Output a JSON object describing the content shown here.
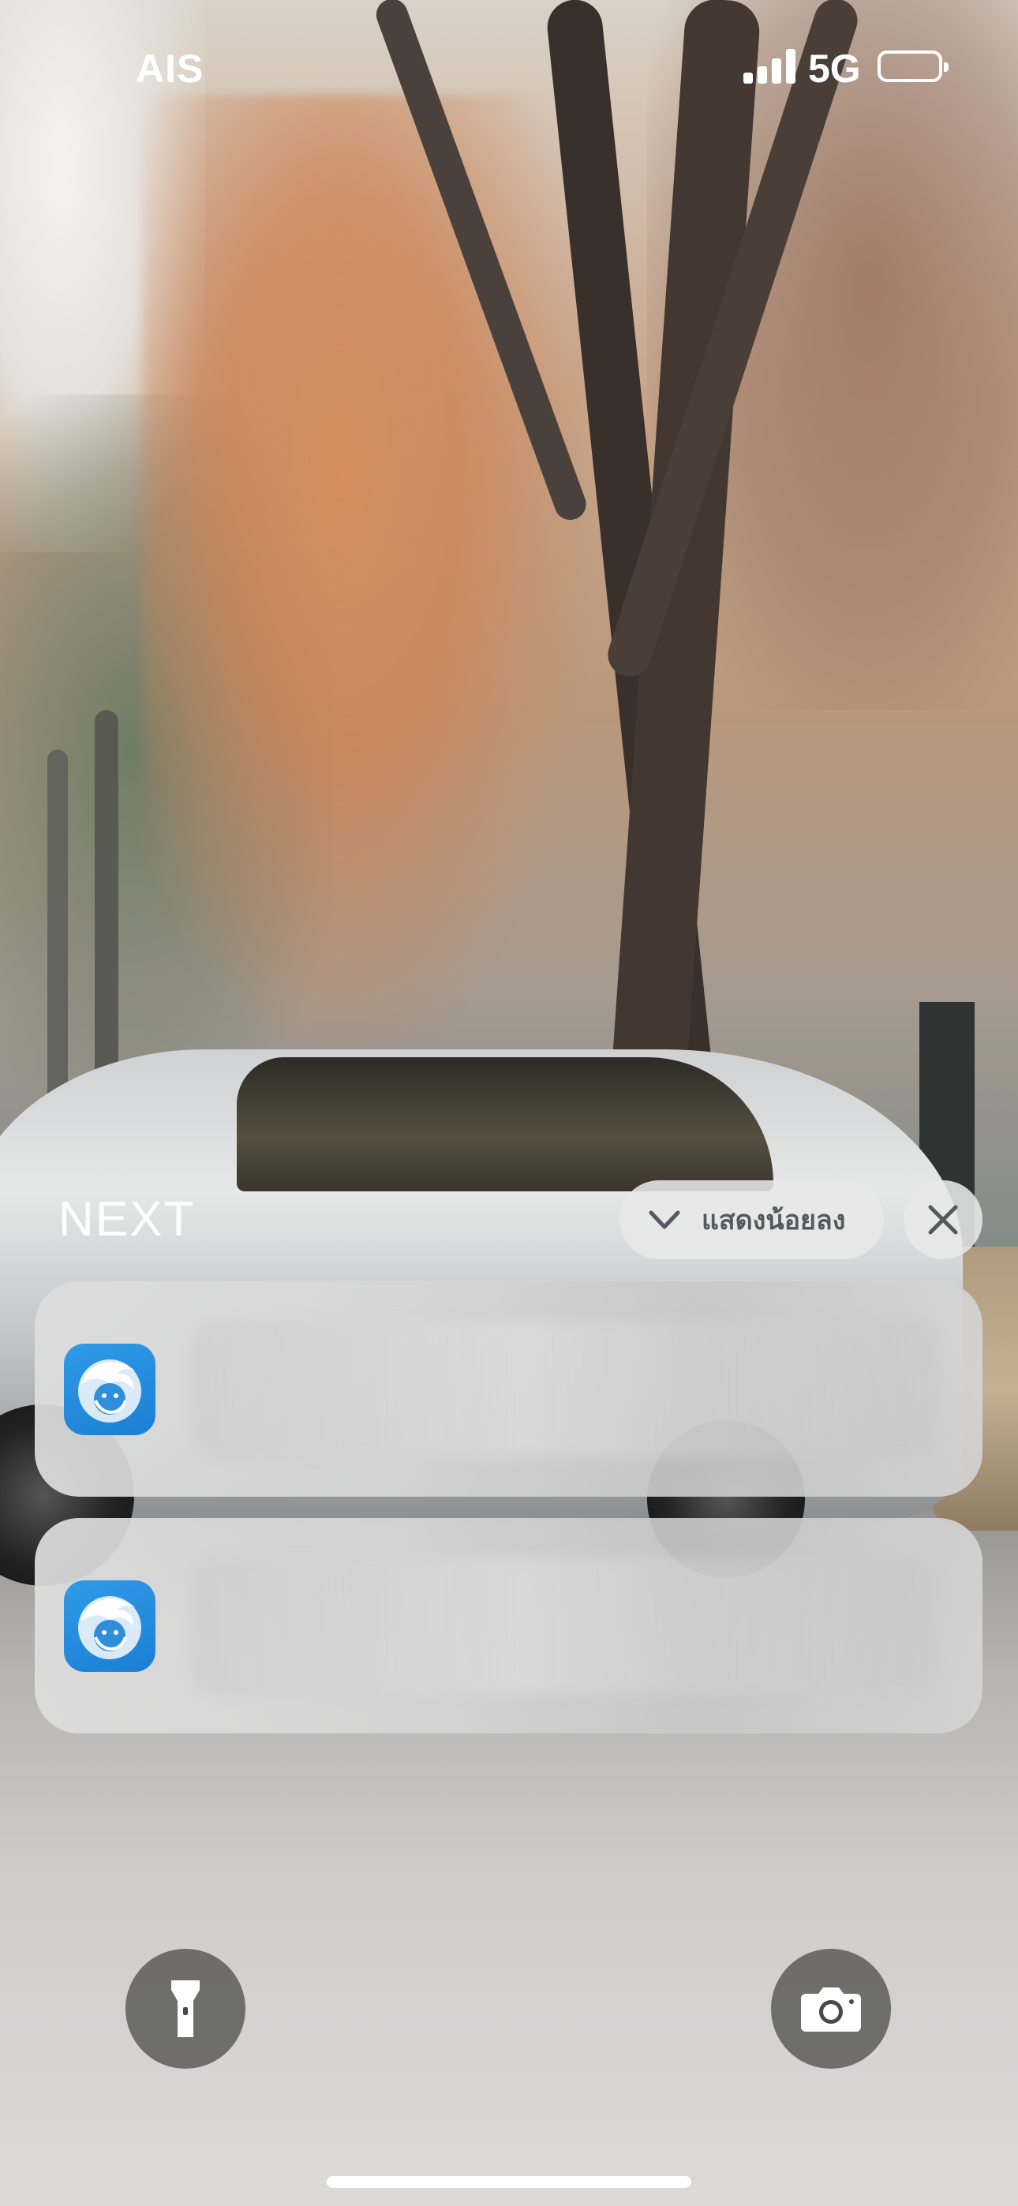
{
  "status_bar": {
    "carrier": "AIS",
    "network_type": "5G",
    "signal_bars": 4,
    "battery_level": 0.0
  },
  "notification_center": {
    "group_label": "NEXT",
    "show_less_label": "แสดงน้อยลง",
    "notifications": [
      {
        "app_icon": "bank-app-icon"
      },
      {
        "app_icon": "bank-app-icon"
      }
    ]
  },
  "quick_actions": {
    "left": "flashlight-icon",
    "right": "camera-icon"
  },
  "colors": {
    "app_icon_blue": "#1b7fd4",
    "pill_background": "#e8e8e8",
    "pill_text": "#55585d"
  }
}
